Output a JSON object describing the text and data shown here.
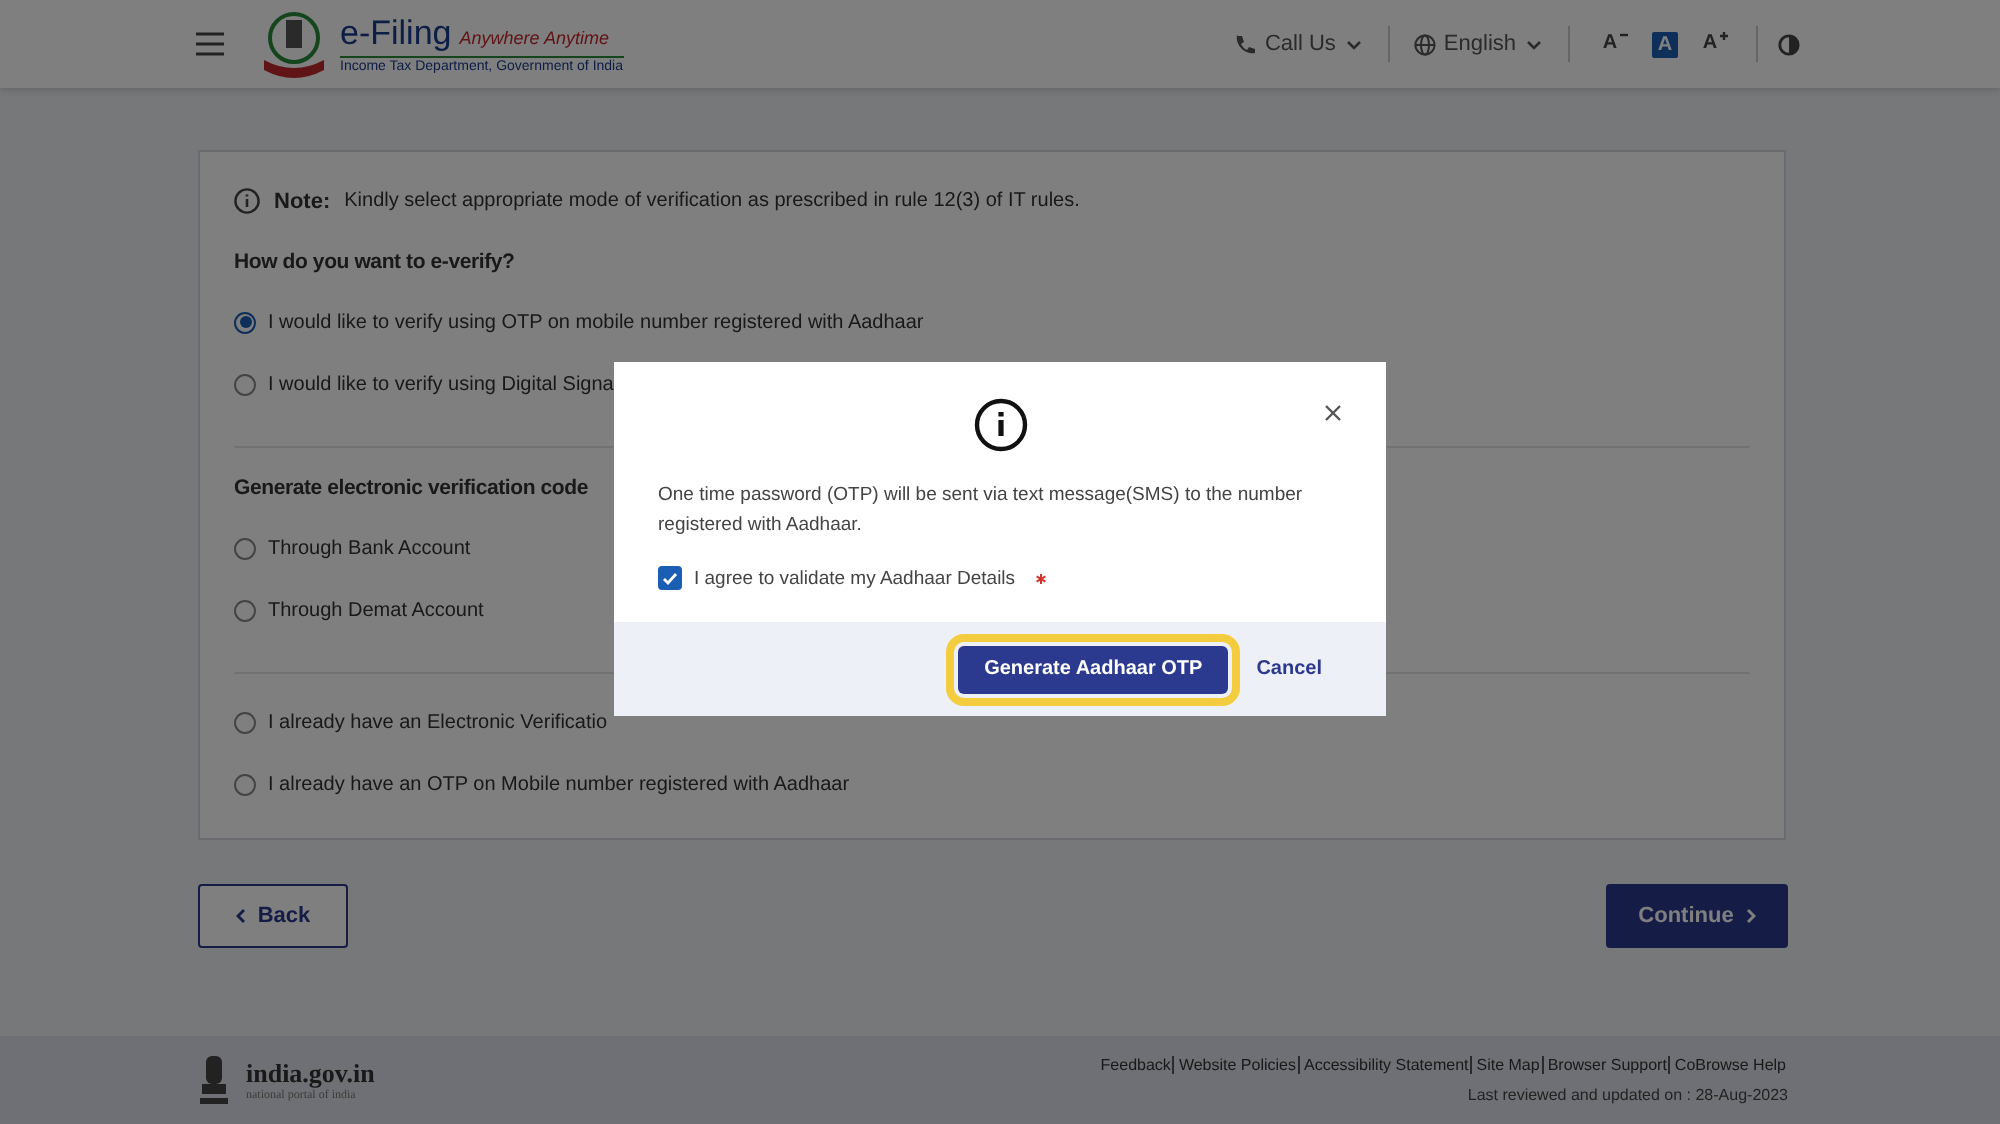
{
  "header": {
    "brand": "e-Filing",
    "tagline": "Anywhere Anytime",
    "department": "Income Tax Department, Government of India",
    "call_us": "Call Us",
    "language": "English",
    "font_size_buttons": [
      {
        "label": "A",
        "kind": "decrease",
        "selected": false
      },
      {
        "label": "A",
        "kind": "default",
        "selected": true
      },
      {
        "label": "A",
        "kind": "increase",
        "selected": false
      }
    ]
  },
  "card": {
    "note_label": "Note:",
    "note_text": "Kindly select appropriate mode of verification as prescribed in rule 12(3) of IT rules.",
    "sections": [
      {
        "heading": "How do you want to e-verify?",
        "options": [
          {
            "label": "I would like to verify using OTP on mobile number registered with Aadhaar",
            "selected": true
          },
          {
            "label": "I would like to verify using Digital Signa",
            "selected": false
          }
        ]
      },
      {
        "heading": "Generate electronic verification code",
        "options": [
          {
            "label": "Through Bank Account",
            "selected": false
          },
          {
            "label": "Through Demat Account",
            "selected": false
          }
        ]
      },
      {
        "options": [
          {
            "label": "I already have an Electronic Verificatio",
            "selected": false
          },
          {
            "label": "I already have an OTP on Mobile number registered with Aadhaar",
            "selected": false
          }
        ]
      }
    ]
  },
  "nav": {
    "back": "Back",
    "continue": "Continue"
  },
  "footer": {
    "portal": "india.gov.in",
    "portal_sub": "national portal of india",
    "links": [
      "Feedback",
      "Website Policies",
      "Accessibility Statement",
      "Site Map",
      "Browser Support",
      "CoBrowse Help"
    ],
    "updated": "Last reviewed and updated on : 28-Aug-2023"
  },
  "modal": {
    "message": "One time password (OTP) will be sent via text message(SMS) to the number registered with Aadhaar.",
    "agree_label": "I agree to validate my Aadhaar Details",
    "agree_checked": true,
    "required": true,
    "primary": "Generate Aadhaar OTP",
    "primary_focused": true,
    "cancel": "Cancel"
  }
}
